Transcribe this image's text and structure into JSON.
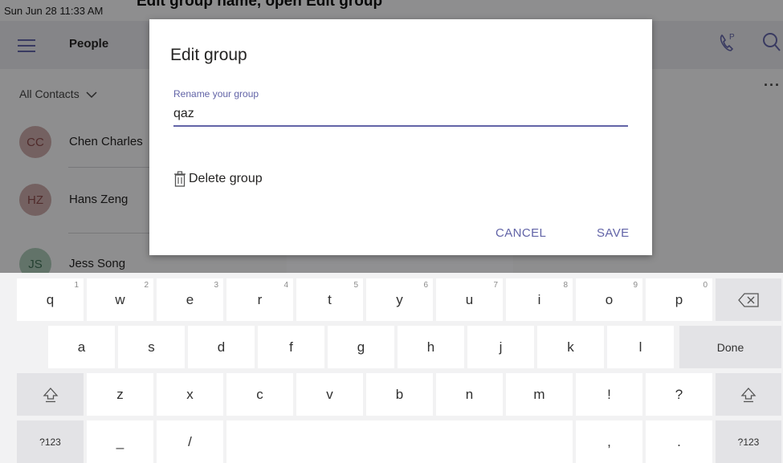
{
  "status_bar": {
    "time": "Sun Jun 28  11:33 AM",
    "clipped_title": "Edit group name, open Edit group"
  },
  "app_bar": {
    "title": "People",
    "icons": [
      "hamburger-menu-icon",
      "call-park-icon",
      "search-icon"
    ]
  },
  "contacts": {
    "filter_label": "All Contacts",
    "more_icon": "···",
    "items": [
      {
        "initials": "CC",
        "name": "Chen Charles",
        "avatar_color": "#c8a8a8"
      },
      {
        "initials": "HZ",
        "name": "Hans Zeng",
        "avatar_color": "#c8a8a8"
      },
      {
        "initials": "JS",
        "name": "Jess Song",
        "avatar_color": "#a9c7b5"
      }
    ]
  },
  "dialog": {
    "title": "Edit group",
    "rename_label": "Rename your group",
    "rename_value": "qaz",
    "delete_label": "Delete group",
    "cancel_label": "CANCEL",
    "save_label": "SAVE",
    "accent_color": "#6264a7"
  },
  "keyboard": {
    "row1": [
      {
        "key": "q",
        "num": "1"
      },
      {
        "key": "w",
        "num": "2"
      },
      {
        "key": "e",
        "num": "3"
      },
      {
        "key": "r",
        "num": "4"
      },
      {
        "key": "t",
        "num": "5"
      },
      {
        "key": "y",
        "num": "6"
      },
      {
        "key": "u",
        "num": "7"
      },
      {
        "key": "i",
        "num": "8"
      },
      {
        "key": "o",
        "num": "9"
      },
      {
        "key": "p",
        "num": "0"
      }
    ],
    "row2": [
      "a",
      "s",
      "d",
      "f",
      "g",
      "h",
      "j",
      "k",
      "l"
    ],
    "done_label": "Done",
    "row3": [
      "z",
      "x",
      "c",
      "v",
      "b",
      "n",
      "m",
      "!",
      "?"
    ],
    "symbols_label": "?123",
    "row4_keys": [
      "_",
      "/",
      ",",
      "."
    ],
    "icons": [
      "backspace-icon",
      "shift-icon"
    ]
  }
}
